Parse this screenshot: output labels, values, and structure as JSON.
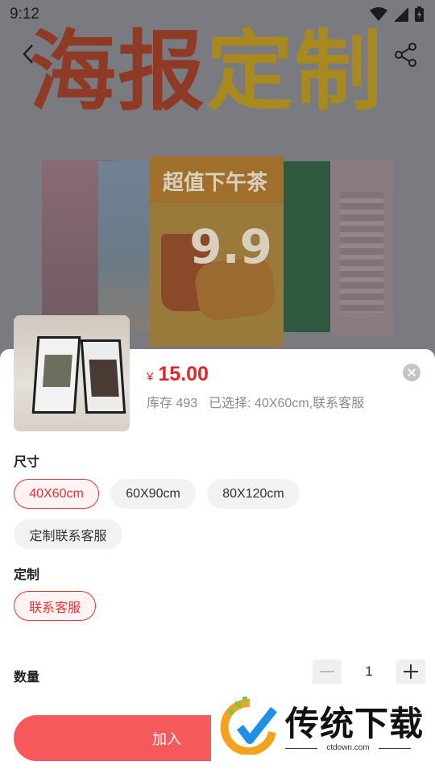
{
  "status_bar": {
    "time": "9:12",
    "icons": [
      "wifi-icon",
      "signal-icon",
      "battery-icon"
    ]
  },
  "header": {
    "back_icon": "chevron-left-icon",
    "share_icon": "share-icon"
  },
  "banner": {
    "title_part1": "海报",
    "title_part2": "定制",
    "featured_poster_text": "超值下午茶",
    "featured_poster_price": "9.9"
  },
  "product": {
    "currency": "¥",
    "price": "15.00",
    "stock": "库存 493",
    "selected": "已选择: 40X60cm,联系客服"
  },
  "size_section": {
    "title": "尺寸",
    "options": [
      "40X60cm",
      "60X90cm",
      "80X120cm",
      "定制联系客服"
    ],
    "selected_index": 0
  },
  "custom_section": {
    "title": "定制",
    "options": [
      "联系客服"
    ],
    "selected_index": 0
  },
  "quantity": {
    "label": "数量",
    "value": "1"
  },
  "actions": {
    "add_to_cart": "加入"
  },
  "watermark": {
    "name": "传统下载",
    "url": "ctdown.com"
  },
  "colors": {
    "accent": "#e3353b",
    "button": "#f5595b",
    "selected_chip_bg": "#fff3f3"
  }
}
